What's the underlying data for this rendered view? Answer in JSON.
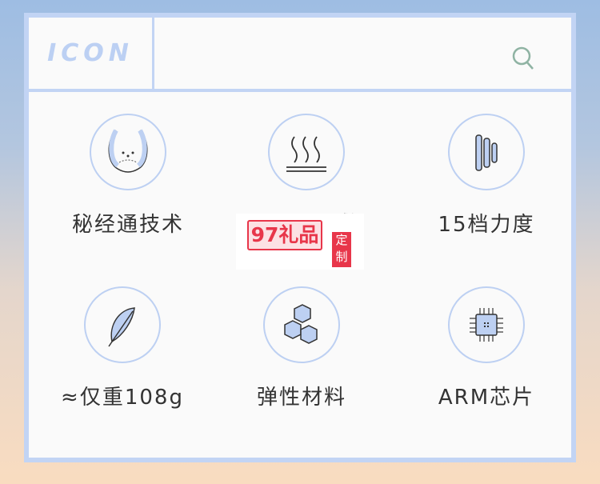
{
  "header": {
    "logo": "ICON",
    "search_icon": "search-icon"
  },
  "features": [
    {
      "label": "秘经通技术",
      "icon": "neck-massager-icon"
    },
    {
      "label": "敷",
      "icon": "heat-icon"
    },
    {
      "label": "15档力度",
      "icon": "intensity-bars-icon"
    },
    {
      "label": "≈仅重108g",
      "icon": "feather-icon"
    },
    {
      "label": "弹性材料",
      "icon": "hexagon-material-icon"
    },
    {
      "label": "ARM芯片",
      "icon": "chip-icon"
    }
  ],
  "watermark": {
    "brand": "97礼品",
    "seal": "定制"
  },
  "colors": {
    "accent": "#c2d4f4",
    "icon_fill": "#bdd0f2",
    "search": "#8fb3a3"
  }
}
